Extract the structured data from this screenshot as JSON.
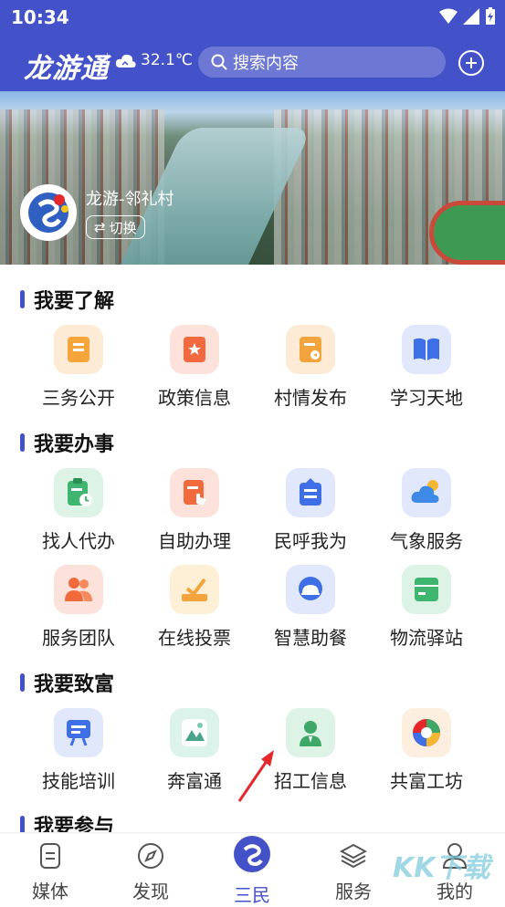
{
  "status": {
    "time": "10:34"
  },
  "header": {
    "logo": "龙游通",
    "temperature": "32.1℃",
    "search_placeholder": "搜索内容"
  },
  "banner": {
    "village": "龙游-邻礼村",
    "switch_label": "切换"
  },
  "sections": [
    {
      "title": "我要了解",
      "items": [
        {
          "label": "三务公开",
          "icon": "document-icon",
          "bg": "#fdebd6",
          "fg": "#f5a53a"
        },
        {
          "label": "政策信息",
          "icon": "star-doc-icon",
          "bg": "#fde2dc",
          "fg": "#f2683f"
        },
        {
          "label": "村情发布",
          "icon": "announce-doc-icon",
          "bg": "#fdebd6",
          "fg": "#f3a43d"
        },
        {
          "label": "学习天地",
          "icon": "book-icon",
          "bg": "#e1e8fb",
          "fg": "#3e6fe6"
        }
      ]
    },
    {
      "title": "我要办事",
      "items": [
        {
          "label": "找人代办",
          "icon": "clipboard-clock-icon",
          "bg": "#dcf3e6",
          "fg": "#3fb56f"
        },
        {
          "label": "自助办理",
          "icon": "hand-doc-icon",
          "bg": "#fde2dc",
          "fg": "#f06a3c"
        },
        {
          "label": "民呼我为",
          "icon": "mailbox-icon",
          "bg": "#e1e8fb",
          "fg": "#3e6fe6"
        },
        {
          "label": "气象服务",
          "icon": "weather-icon",
          "bg": "#e1e8fb",
          "fg": "#3e8ae6"
        },
        {
          "label": "服务团队",
          "icon": "team-icon",
          "bg": "#fde2dc",
          "fg": "#f06a3c"
        },
        {
          "label": "在线投票",
          "icon": "vote-icon",
          "bg": "#fdf0d6",
          "fg": "#f3a43d"
        },
        {
          "label": "智慧助餐",
          "icon": "dining-icon",
          "bg": "#e1e8fb",
          "fg": "#3e6fe6"
        },
        {
          "label": "物流驿站",
          "icon": "package-icon",
          "bg": "#dcf3e6",
          "fg": "#3fb56f"
        }
      ]
    },
    {
      "title": "我要致富",
      "items": [
        {
          "label": "技能培训",
          "icon": "training-board-icon",
          "bg": "#e1e8fb",
          "fg": "#3e6fe6"
        },
        {
          "label": "奔富通",
          "icon": "benfutong-logo-icon",
          "bg": "#dcf3ec",
          "fg": "#4aa38a"
        },
        {
          "label": "招工信息",
          "icon": "worker-icon",
          "bg": "#dcf3e6",
          "fg": "#3fa868"
        },
        {
          "label": "共富工坊",
          "icon": "gongfu-logo-icon",
          "bg": "#fdefe0",
          "fg": "#e8843a"
        }
      ]
    },
    {
      "title": "我要参与",
      "items": []
    }
  ],
  "tabbar": [
    {
      "label": "媒体",
      "icon": "media-icon",
      "active": false
    },
    {
      "label": "发现",
      "icon": "compass-icon",
      "active": false
    },
    {
      "label": "三民",
      "icon": "sanmin-logo-icon",
      "active": true
    },
    {
      "label": "服务",
      "icon": "layers-icon",
      "active": false
    },
    {
      "label": "我的",
      "icon": "user-icon",
      "active": false
    }
  ],
  "watermark": "KK下载",
  "colors": {
    "primary": "#4352c8",
    "accent_red": "#e5262b"
  }
}
